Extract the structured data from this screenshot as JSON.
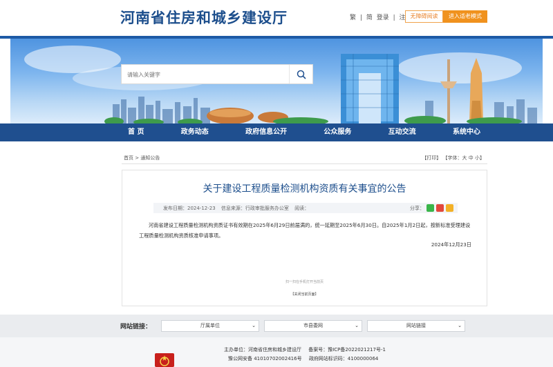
{
  "header": {
    "site_title": "河南省住房和城乡建设厅",
    "links": [
      "繁",
      "|",
      "简",
      "登录",
      "|",
      "注册"
    ],
    "accessibility_label": "无障碍阅读",
    "elder_mode_label": "进入适老模式"
  },
  "search": {
    "placeholder": "请输入关键字"
  },
  "nav": {
    "items": [
      "首 页",
      "政务动态",
      "政府信息公开",
      "公众服务",
      "互动交流",
      "系统中心"
    ]
  },
  "breadcrumb": {
    "home": "首页",
    "sep": ">",
    "current": "通知公告",
    "tools": "【打印】 【字体：大 中 小】"
  },
  "article": {
    "title": "关于建设工程质量检测机构资质有关事宜的公告",
    "publish_date": "发布日期：2024-12-23",
    "source": "信息来源：行政审批服务办公室",
    "views": "阅读：",
    "share_label": "分享：",
    "body": "河南省建设工程质量检测机构资质证书有效期在2025年6月29日前届满的，统一延期至2025年6月30日。自2025年1月2日起，按新标准受理建设工程质量检测机构资质核准申请事项。",
    "date": "2024年12月23日",
    "footnote": "扫一扫在手机打开当前页",
    "close_label": "【关闭当前页面】"
  },
  "links_bar": {
    "label": "网站链接：",
    "selects": [
      "厅属单位",
      "市县委网",
      "网站链接"
    ]
  },
  "footer": {
    "line1": [
      "主办单位：河南省住房和城乡建设厅",
      "备案号：豫ICP备2022021217号-1"
    ],
    "line2": [
      "豫公网安备 41010702002416号",
      "政府网站标识码：4100000064"
    ]
  },
  "colors": {
    "primary": "#1f4f8f",
    "title_blue": "#1c4e8c",
    "accent_orange": "#f0921e"
  }
}
